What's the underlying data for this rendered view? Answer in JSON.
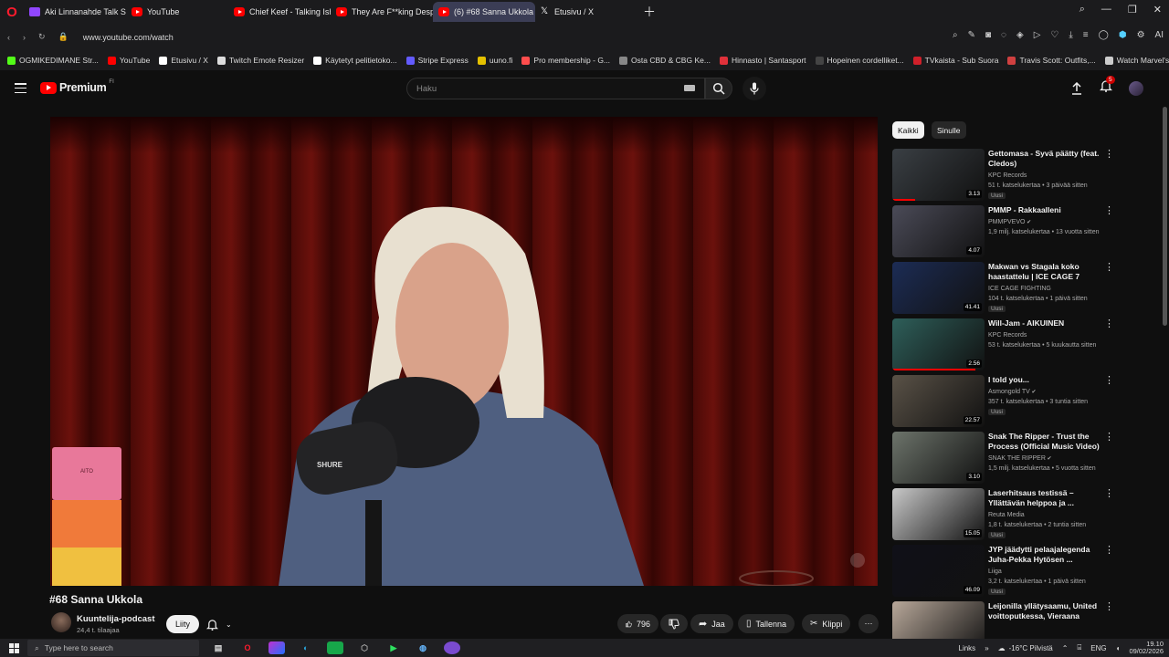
{
  "browser": {
    "tabs": [
      {
        "label": "Aki Linnanahde Talk Show",
        "icon": "twitch-icon",
        "active": false
      },
      {
        "label": "YouTube",
        "icon": "youtube-icon",
        "active": false
      },
      {
        "label": "Chief Keef - Talking Ish",
        "icon": "youtube-icon",
        "active": false
      },
      {
        "label": "They Are F**king Desperate",
        "icon": "youtube-icon",
        "active": false
      },
      {
        "label": "(6) #68 Sanna Ukkola",
        "icon": "youtube-icon",
        "active": true
      },
      {
        "label": "Etusivu / X",
        "icon": "x-icon",
        "active": false
      }
    ],
    "url": "www.youtube.com/watch",
    "ai_label": "AI",
    "bookmarks": [
      {
        "label": "OGMIKEDIMANE Str...",
        "color": "#53fc18"
      },
      {
        "label": "YouTube",
        "color": "#ff0000"
      },
      {
        "label": "Etusivu / X",
        "color": "#ffffff"
      },
      {
        "label": "Twitch Emote Resizer",
        "color": "#dddddd"
      },
      {
        "label": "Käytetyt pelitietoko...",
        "color": "#ffffff"
      },
      {
        "label": "Stripe Express",
        "color": "#635bff"
      },
      {
        "label": "uuno.fi",
        "color": "#e5c100"
      },
      {
        "label": "Pro membership - G...",
        "color": "#ff4d4d"
      },
      {
        "label": "Osta CBD & CBG Ke...",
        "color": "#888888"
      },
      {
        "label": "Hinnasto | Santasport",
        "color": "#e0313a"
      },
      {
        "label": "Hopeinen cordelliket...",
        "color": "#444444"
      },
      {
        "label": "TVkaista - Sub Suora",
        "color": "#d0202a"
      },
      {
        "label": "Travis Scott: Outfits,...",
        "color": "#d04040"
      },
      {
        "label": "Watch Marvel's Luk...",
        "color": "#cccccc"
      }
    ]
  },
  "yt": {
    "logo_text": "Premium",
    "logo_country": "FI",
    "search_placeholder": "Haku",
    "notifications_count": "5",
    "video": {
      "title": "#68 Sanna Ukkola",
      "channel": "Kuuntelija-podcast",
      "subs": "24,4 t. tilaajaa",
      "join_label": "Liity",
      "likes": "796",
      "share_label": "Jaa",
      "save_label": "Tallenna",
      "clip_label": "Klippi",
      "mic_brand": "SHURE"
    },
    "chips": [
      "Kaikki",
      "Sinulle"
    ],
    "recommendations": [
      {
        "title": "Gettomasa - Syvä päätty (feat. Cledos)",
        "channel": "KPC Records",
        "verified": false,
        "meta": "51 t. katselukertaa • 3 päivää sitten",
        "new": "Uusi",
        "duration": "3.13",
        "progress": 0.25,
        "thumb": "#3a3f44"
      },
      {
        "title": "PMMP - Rakkaalleni",
        "channel": "PMMPVEVO",
        "verified": true,
        "meta": "1,9 milj. katselukertaa • 13 vuotta sitten",
        "new": "",
        "duration": "4.07",
        "progress": 0,
        "thumb": "#4b4b58"
      },
      {
        "title": "Makwan vs Stagala koko haastattelu | ICE CAGE 7",
        "channel": "ICE CAGE FIGHTING",
        "verified": false,
        "meta": "104 t. katselukertaa • 1 päivä sitten",
        "new": "Uusi",
        "duration": "41.41",
        "progress": 0,
        "thumb": "#1c2c55"
      },
      {
        "title": "Will-Jam - AIKUINEN",
        "channel": "KPC Records",
        "verified": false,
        "meta": "53 t. katselukertaa • 5 kuukautta sitten",
        "new": "",
        "duration": "2.56",
        "progress": 0.9,
        "thumb": "#2e5f5a"
      },
      {
        "title": "I told you...",
        "channel": "Asmongold TV",
        "verified": true,
        "meta": "357 t. katselukertaa • 3 tuntia sitten",
        "new": "Uusi",
        "duration": "22.57",
        "progress": 0,
        "thumb": "#5a5247"
      },
      {
        "title": "Snak The Ripper - Trust the Process (Official Music Video)",
        "channel": "SNAK THE RIPPER",
        "verified": true,
        "meta": "1,5 milj. katselukertaa • 5 vuotta sitten",
        "new": "",
        "duration": "3.10",
        "progress": 0,
        "thumb": "#6d746b"
      },
      {
        "title": "Laserhitsaus testissä – Yllättävän helppoa ja ...",
        "channel": "Reuta Media",
        "verified": false,
        "meta": "1,8 t. katselukertaa • 2 tuntia sitten",
        "new": "Uusi",
        "duration": "15.05",
        "progress": 0,
        "thumb": "#c8c8c8"
      },
      {
        "title": "JYP jäädytti pelaajalegenda Juha-Pekka Hytösen ...",
        "channel": "Liiga",
        "verified": false,
        "meta": "3,2 t. katselukertaa • 1 päivä sitten",
        "new": "Uusi",
        "duration": "46.09",
        "progress": 0,
        "thumb": "#101018"
      },
      {
        "title": "Leijonilla yllätysaamu, United voittoputkessa, Vieraana Lass...",
        "channel": "",
        "verified": false,
        "meta": "",
        "new": "",
        "duration": "",
        "progress": 0,
        "thumb": "#b8a89a"
      }
    ]
  },
  "taskbar": {
    "search_placeholder": "Type here to search",
    "links_label": "Links",
    "weather": "-16°C  Pilvistä",
    "lang": "ENG",
    "time": "19.10",
    "date": "09/02/2026"
  }
}
